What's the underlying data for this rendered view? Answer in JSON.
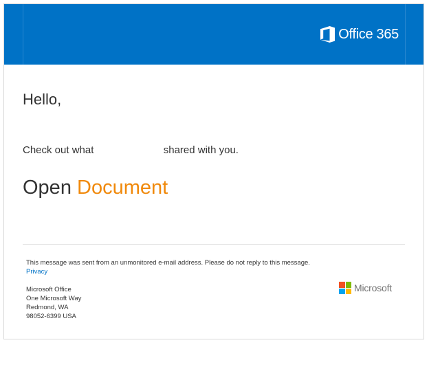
{
  "header": {
    "brand_text": "Office 365",
    "banner_color": "#0072c6",
    "logo_icon": "office-logo-icon"
  },
  "body": {
    "greeting": "Hello,",
    "share_prefix": "Check out what",
    "share_suffix": "shared with you.",
    "open_word": "Open",
    "document_word": "Document",
    "document_color": "#f0890b"
  },
  "footer": {
    "notice": "This message was sent from an unmonitored e-mail address. Please do not reply to this message.",
    "privacy_label": "Privacy",
    "address_lines": [
      "Microsoft Office",
      "One Microsoft Way",
      "Redmond, WA",
      "98052-6399 USA"
    ],
    "ms_logo_text": "Microsoft",
    "ms_colors": [
      "#f25022",
      "#7fba00",
      "#00a4ef",
      "#ffb900"
    ]
  }
}
